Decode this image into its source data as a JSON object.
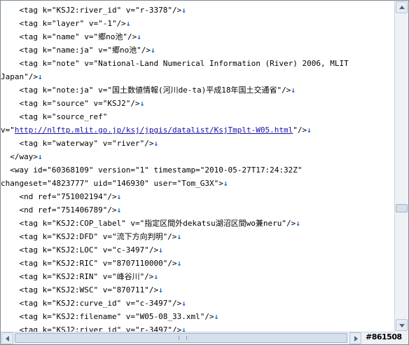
{
  "lines": [
    "    <tag k=\"KSJ2:river_id\" v=\"r-3378\"/>",
    "    <tag k=\"layer\" v=\"-1\"/>",
    "    <tag k=\"name\" v=\"郷no池\"/>",
    "    <tag k=\"name:ja\" v=\"郷no池\"/>",
    "    <tag k=\"note\" v=\"National-Land Numerical Information (River) 2006, MLIT",
    "Japan\"/>",
    "    <tag k=\"note:ja\" v=\"国土数値情報(河川de-ta)平成18年国土交通省\"/>",
    "    <tag k=\"source\" v=\"KSJ2\"/>",
    "    <tag k=\"source_ref\"",
    "v=\"",
    "    <tag k=\"waterway\" v=\"river\"/>",
    "  </way>",
    "  <way id=\"60368109\" version=\"1\" timestamp=\"2010-05-27T17:24:32Z\"",
    "changeset=\"4823777\" uid=\"146930\" user=\"Tom_G3X\">",
    "    <nd ref=\"751002194\"/>",
    "    <nd ref=\"751406789\"/>",
    "    <tag k=\"KSJ2:COP_label\" v=\"指定区間外dekatsu湖沼区間wo兼neru\"/>",
    "    <tag k=\"KSJ2:DFD\" v=\"流下方向判明\"/>",
    "    <tag k=\"KSJ2:LOC\" v=\"c-3497\"/>",
    "    <tag k=\"KSJ2:RIC\" v=\"8707110000\"/>",
    "    <tag k=\"KSJ2:RIN\" v=\"峰谷川\"/>",
    "    <tag k=\"KSJ2:WSC\" v=\"870711\"/>",
    "    <tag k=\"KSJ2:curve_id\" v=\"c-3497\"/>",
    "    <tag k=\"KSJ2:filename\" v=\"W05-08_33.xml\"/>",
    "    <tag k=\"KSJ2:river_id\" v=\"r-3497\"/>"
  ],
  "link_line": 9,
  "link_text": "http://nlftp.mlit.go.jp/ksj/jpgis/datalist/KsjTmplt-W05.html",
  "link_suffix": "\"/>",
  "newline_glyph": "↓",
  "no_newline_lines": [
    4,
    8,
    12
  ],
  "watermark": "#861508",
  "icons": {
    "scroll_up": "arrow-up-icon",
    "scroll_down": "arrow-down-icon",
    "scroll_left": "arrow-left-icon",
    "scroll_right": "arrow-right-icon"
  }
}
